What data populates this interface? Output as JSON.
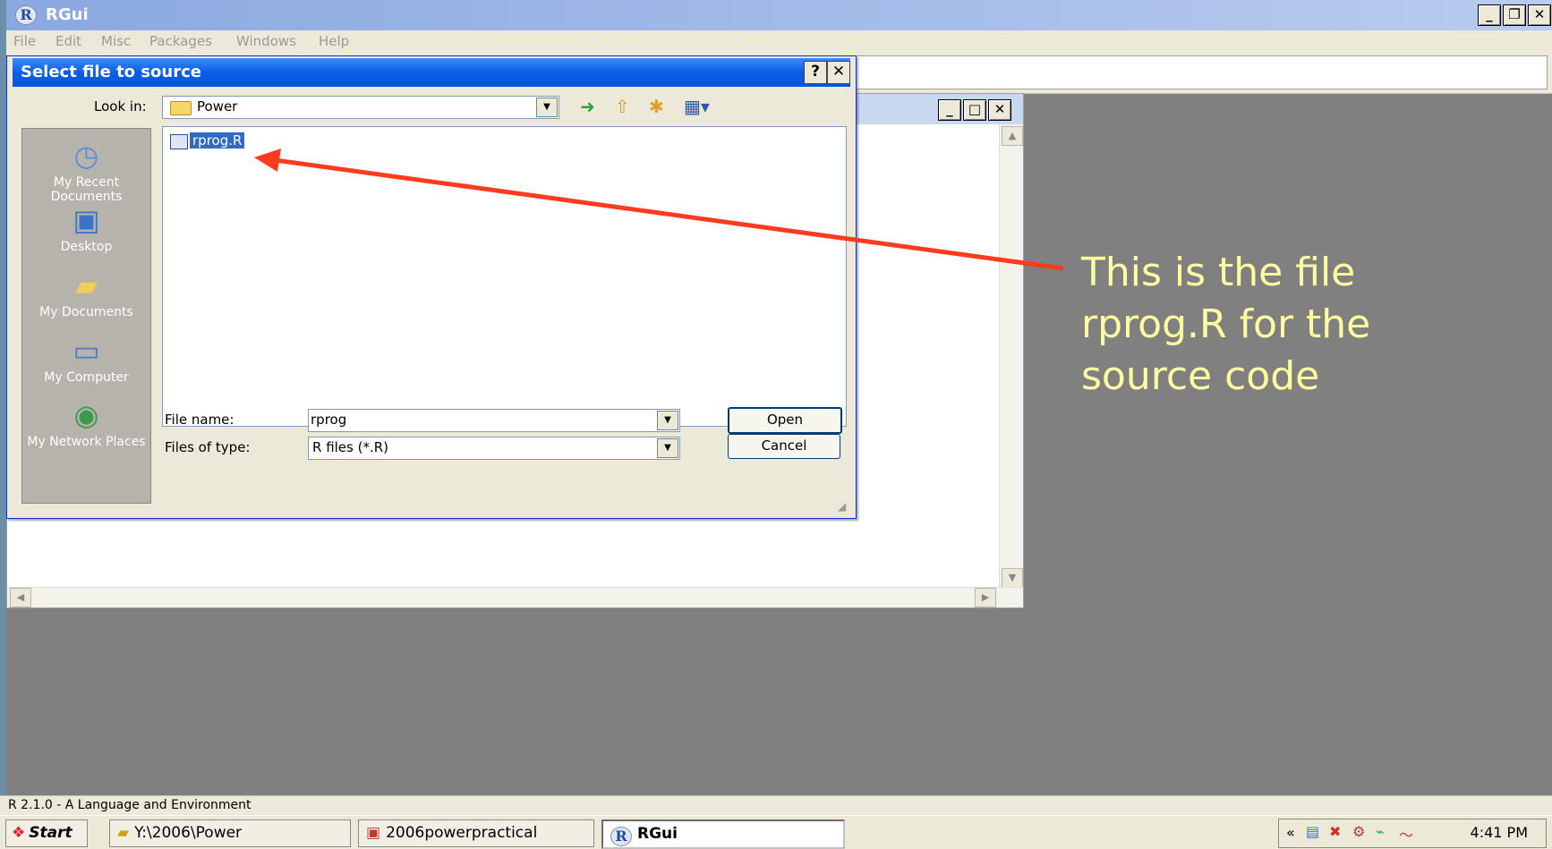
{
  "rgui": {
    "title": "RGui",
    "menu": [
      "File",
      "Edit",
      "Misc",
      "Packages",
      "Windows",
      "Help"
    ],
    "status": "R 2.1.0 - A Language and Environment"
  },
  "dialog": {
    "title": "Select file to source",
    "help_label": "?",
    "close_label": "✕",
    "look_in_label": "Look in:",
    "look_in_value": "Power",
    "places": [
      {
        "label": "My Recent Documents",
        "icon": "recent-documents-icon"
      },
      {
        "label": "Desktop",
        "icon": "desktop-icon"
      },
      {
        "label": "My Documents",
        "icon": "my-documents-icon"
      },
      {
        "label": "My Computer",
        "icon": "my-computer-icon"
      },
      {
        "label": "My Network Places",
        "icon": "network-places-icon"
      }
    ],
    "files": [
      {
        "name": "rprog.R"
      }
    ],
    "file_name_label": "File name:",
    "file_name_value": "rprog",
    "file_type_label": "Files of type:",
    "file_type_value": "R files (*.R)",
    "open_label": "Open",
    "cancel_label": "Cancel"
  },
  "annotation": {
    "lines": [
      "This is the file",
      "rprog.R for the",
      "source code"
    ],
    "color": "#ffffa0",
    "arrow_color": "#ff3b1f"
  },
  "taskbar": {
    "start_label": "Start",
    "tasks": [
      "Y:\\2006\\Power",
      "2006powerpractical",
      "RGui"
    ],
    "clock": "4:41 PM",
    "tray_chevron": "«"
  }
}
